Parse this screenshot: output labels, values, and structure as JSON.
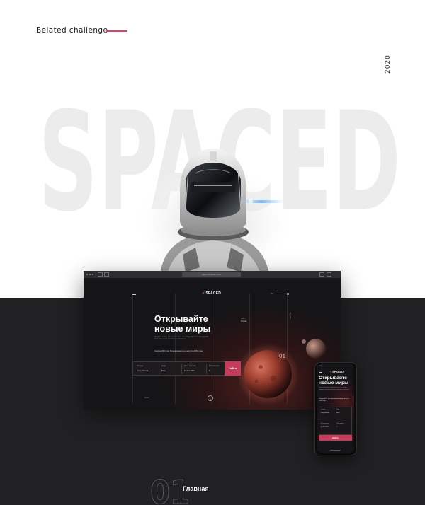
{
  "header": {
    "title": "Belated challenge",
    "year": "2020",
    "accent_color": "#d8436a"
  },
  "hero": {
    "big_word": "SPACED",
    "image_icon": "astronaut-helmet-illustration"
  },
  "browser": {
    "url": "spaced.artist.com",
    "page": {
      "logo": "SPACED",
      "headline_line1": "Открывайте",
      "headline_line2": "новые миры",
      "description": "Тут какой-нибудь интересный текст, что-нибудь связанное про далекий край, вашу мечту о космосе в этом месте",
      "promo": "Скидка 30% при бронировании до августа 2050 года",
      "weather": "-12°C",
      "weather_city": "Москва",
      "side_label": "Загрузить",
      "slide_number": "01",
      "scroll_label": "Scroll",
      "lang": "RU",
      "search": {
        "from_label": "Откуда",
        "from_value": "город Москва",
        "to_label": "Куда",
        "to_value": "Весь",
        "date_label": "Дата вылета",
        "date_value": "9 / 03 / 2050",
        "passengers_label": "Пассажиры",
        "passengers_value": "1",
        "button": "Найти"
      }
    }
  },
  "phone": {
    "time": "9:41",
    "logo": "SPACED",
    "headline_line1": "Открывайте",
    "headline_line2": "новые миры",
    "description": "Тут какой-нибудь интересный текст, что-нибудь связанное про далекий край, вашу мечту о космосе",
    "promo": "Скидка 30% при бронировании до августа 2050 года",
    "search": {
      "from_label": "Откуда",
      "from_value": "город Москва",
      "to_label": "Куда",
      "to_value": "Весь",
      "date_label": "Дата вылета",
      "date_value": "9 / 03 / 2050",
      "passengers_label": "Пассажиры",
      "passengers_value": "1",
      "button": "Найти"
    }
  },
  "section": {
    "number": "01",
    "label": "Главная"
  },
  "colors": {
    "dark_background": "#212123",
    "page_background": "#151416",
    "button": "#c63b5c"
  }
}
